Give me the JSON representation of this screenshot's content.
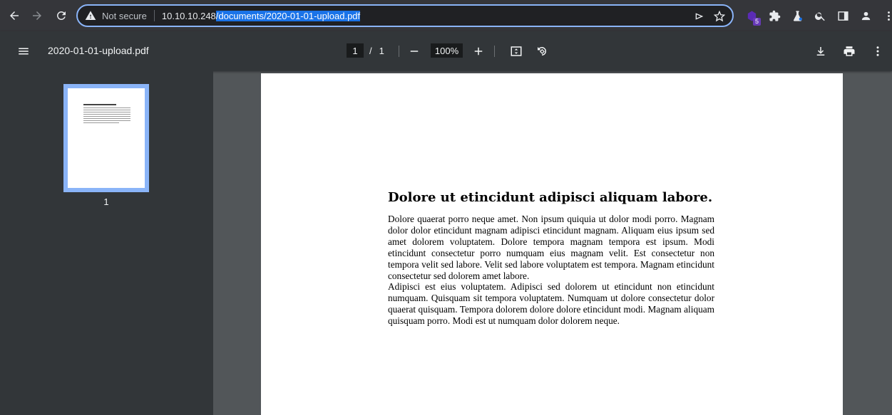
{
  "browser": {
    "security_label": "Not secure",
    "url_host": "10.10.10.248",
    "url_path": "/documents/2020-01-01-upload.pdf",
    "extension_badge": "5"
  },
  "pdf_toolbar": {
    "title": "2020-01-01-upload.pdf",
    "current_page": "1",
    "page_separator": "/",
    "total_pages": "1",
    "zoom": "100%"
  },
  "sidebar": {
    "thumbnails": [
      {
        "label": "1"
      }
    ]
  },
  "document": {
    "title": "Dolore ut etincidunt adipisci aliquam labore.",
    "paragraphs": [
      "Dolore quaerat porro neque amet.  Non ipsum quiquia ut dolor modi porro. Magnam dolor dolor etincidunt magnam adipisci etincidunt magnam. Aliquam eius ipsum sed amet dolorem voluptatem.  Dolore tempora magnam tempora est ipsum.  Modi etincidunt consectetur porro numquam eius magnam velit. Est consectetur non tempora velit sed labore.  Velit sed labore voluptatem est tempora. Magnam etincidunt consectetur sed dolorem amet labore.",
      "Adipisci est eius voluptatem. Adipisci sed dolorem ut etincidunt non etincidunt numquam.  Quisquam sit tempora voluptatem.  Numquam ut dolore consectetur dolor quaerat quisquam.  Tempora dolorem dolore dolore etincidunt modi. Magnam aliquam quisquam porro. Modi est ut numquam dolor dolorem neque."
    ]
  },
  "colors": {
    "accent": "#8ab4f8",
    "selection": "#1a73e8",
    "toolbar": "#323639",
    "browser_bar": "#35363a",
    "viewer_bg": "#525659"
  }
}
